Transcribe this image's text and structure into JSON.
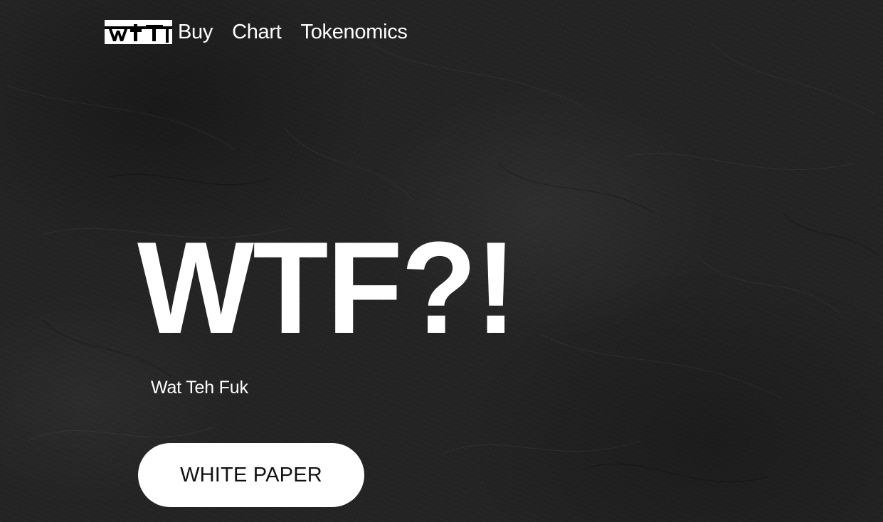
{
  "logo": {
    "text": "wtf",
    "icon": "wtf-logo-icon"
  },
  "nav": {
    "links": [
      {
        "label": "Buy"
      },
      {
        "label": "Chart"
      },
      {
        "label": "Tokenomics"
      }
    ]
  },
  "hero": {
    "headline": "WTF?!",
    "tagline": "Wat Teh Fuk",
    "cta_label": "WHITE PAPER"
  },
  "colors": {
    "background": "#232323",
    "text": "#ffffff",
    "button_background": "#ffffff",
    "button_text": "#111111"
  }
}
